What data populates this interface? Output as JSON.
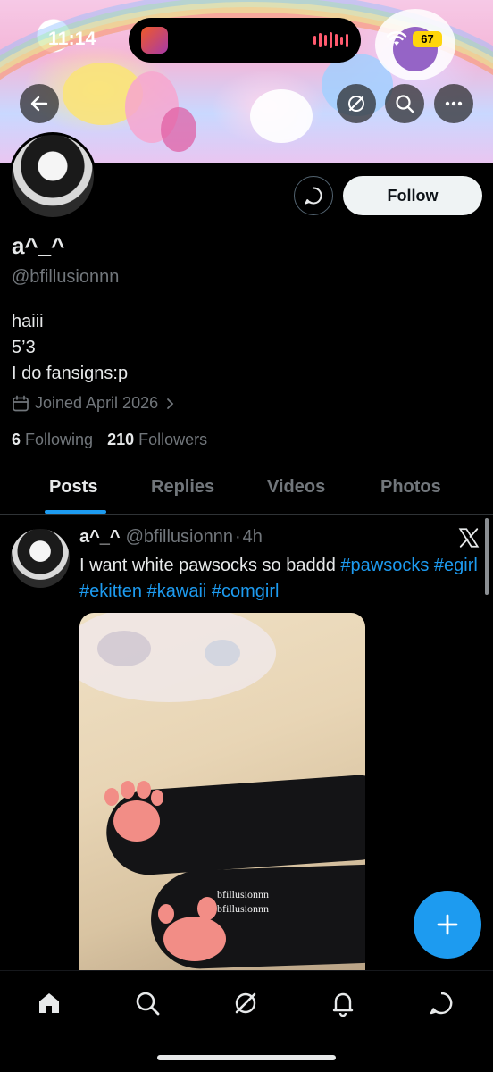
{
  "status_bar": {
    "time": "11:14",
    "battery": "67",
    "battery_color": "#ffd60a"
  },
  "header": {
    "back_icon": "arrow-left-icon",
    "grok_icon": "grok-icon",
    "search_icon": "search-icon",
    "more_icon": "more-horizontal-icon"
  },
  "profile": {
    "display_name": "a^_^",
    "handle": "@bfillusionnn",
    "bio_lines": [
      "haiii",
      "5’3",
      "I do fansigns:p"
    ],
    "joined": "Joined April 2026",
    "following_count": "6",
    "following_label": "Following",
    "followers_count": "210",
    "followers_label": "Followers",
    "follow_button": "Follow"
  },
  "tabs": [
    {
      "label": "Posts",
      "active": true
    },
    {
      "label": "Replies",
      "active": false
    },
    {
      "label": "Videos",
      "active": false
    },
    {
      "label": "Photos",
      "active": false
    }
  ],
  "post": {
    "name": "a^_^",
    "handle": "@bfillusionnn",
    "separator": "·",
    "time": "4h",
    "text": "I want white pawsocks so baddd",
    "hashtags": [
      "#pawsocks",
      "#egirl",
      "#ekitten",
      "#kawaii",
      "#comgirl"
    ],
    "watermark_1": "bfillusionnn",
    "watermark_2": "bfillusionnn"
  },
  "bottom_nav": [
    "home-icon",
    "search-icon",
    "grok-icon",
    "bell-icon",
    "messages-icon"
  ],
  "colors": {
    "accent": "#1d9bf0",
    "text_primary": "#e7e9ea",
    "text_secondary": "#71767b",
    "background": "#000000"
  }
}
